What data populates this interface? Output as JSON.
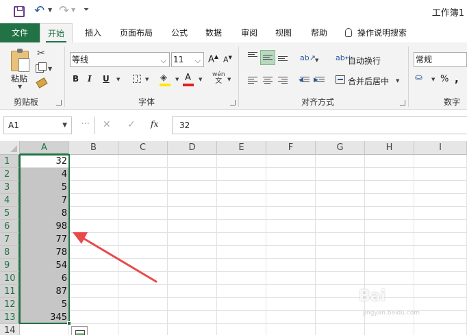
{
  "window": {
    "title": "工作簿1"
  },
  "tabs": {
    "file": "文件",
    "home": "开始",
    "insert": "插入",
    "page_layout": "页面布局",
    "formulas": "公式",
    "data": "数据",
    "review": "审阅",
    "view": "视图",
    "help": "帮助",
    "tell_me": "操作说明搜索"
  },
  "ribbon": {
    "clipboard": {
      "paste": "粘贴",
      "label": "剪贴板"
    },
    "font": {
      "name": "等线",
      "size": "11",
      "grow": "A",
      "shrink": "A",
      "bold": "B",
      "italic": "I",
      "underline": "U",
      "font_color_glyph": "A",
      "pinyin_top": "wén",
      "pinyin_bottom": "文",
      "label": "字体"
    },
    "alignment": {
      "wrap_text": "自动换行",
      "merge_center": "合并后居中",
      "label": "对齐方式"
    },
    "number": {
      "format": "常规",
      "percent": "%",
      "comma": ",",
      "label": "数字"
    }
  },
  "formula_bar": {
    "name_box": "A1",
    "fx": "fx",
    "value": "32"
  },
  "grid": {
    "columns": [
      "A",
      "B",
      "C",
      "D",
      "E",
      "F",
      "G",
      "H",
      "I"
    ],
    "rows": [
      "1",
      "2",
      "3",
      "4",
      "5",
      "6",
      "7",
      "8",
      "9",
      "10",
      "11",
      "12",
      "13",
      "14"
    ],
    "column_a_values": [
      "32",
      "4",
      "5",
      "7",
      "8",
      "98",
      "77",
      "78",
      "54",
      "6",
      "87",
      "5",
      "345"
    ]
  },
  "colors": {
    "accent": "#217346",
    "selection_fill": "#c6c6c6",
    "arrow": "#e84a4a"
  },
  "watermark": {
    "brand": "Bai",
    "sub": "jingyan.baidu.com"
  }
}
